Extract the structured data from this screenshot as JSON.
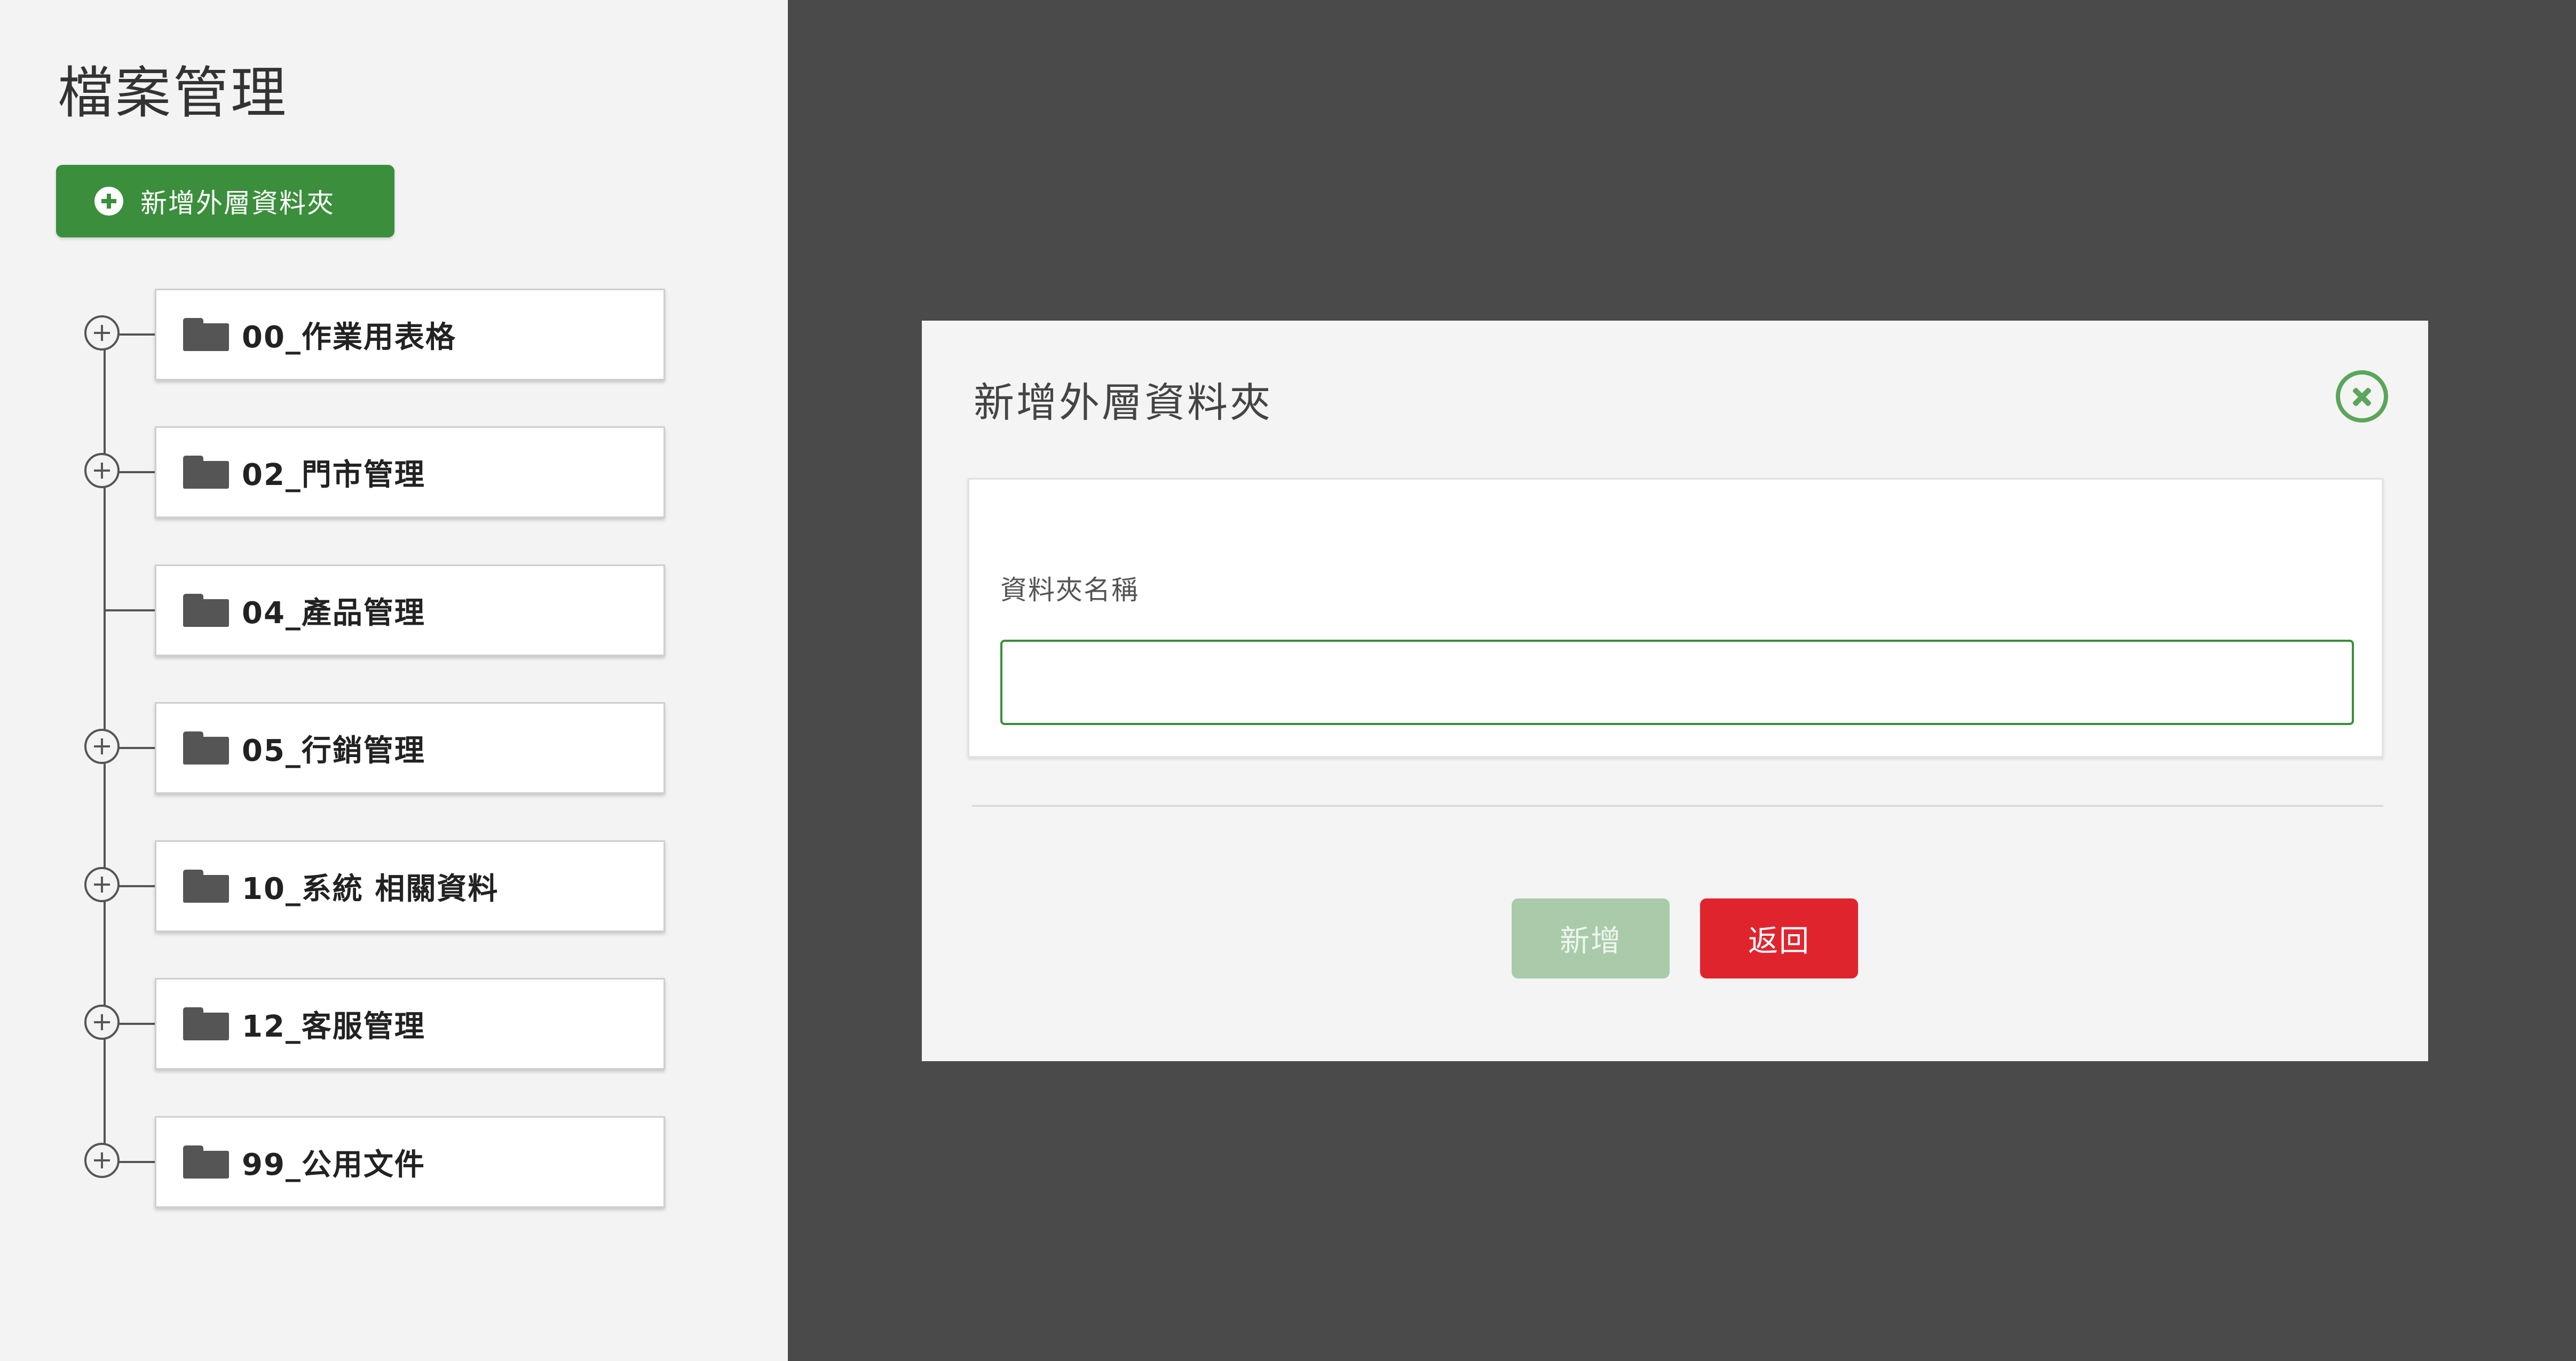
{
  "page": {
    "title": "檔案管理"
  },
  "toolbar": {
    "add_root_folder_label": "新增外層資料夾"
  },
  "tree": {
    "items": [
      {
        "name": "00_作業用表格",
        "expandable": true
      },
      {
        "name": "02_門市管理",
        "expandable": true
      },
      {
        "name": "04_產品管理",
        "expandable": false
      },
      {
        "name": "05_行銷管理",
        "expandable": true
      },
      {
        "name": "10_系統 相關資料",
        "expandable": true
      },
      {
        "name": "12_客服管理",
        "expandable": true
      },
      {
        "name": "99_公用文件",
        "expandable": true
      }
    ]
  },
  "modal": {
    "title": "新增外層資料夾",
    "field_label": "資料夾名稱",
    "field_value": "",
    "add_button": "新增",
    "back_button": "返回"
  },
  "colors": {
    "primary_green": "#3b8e3c",
    "disabled_green": "#a9cba9",
    "danger_red": "#e0242e",
    "overlay": "#4a4a4a"
  }
}
